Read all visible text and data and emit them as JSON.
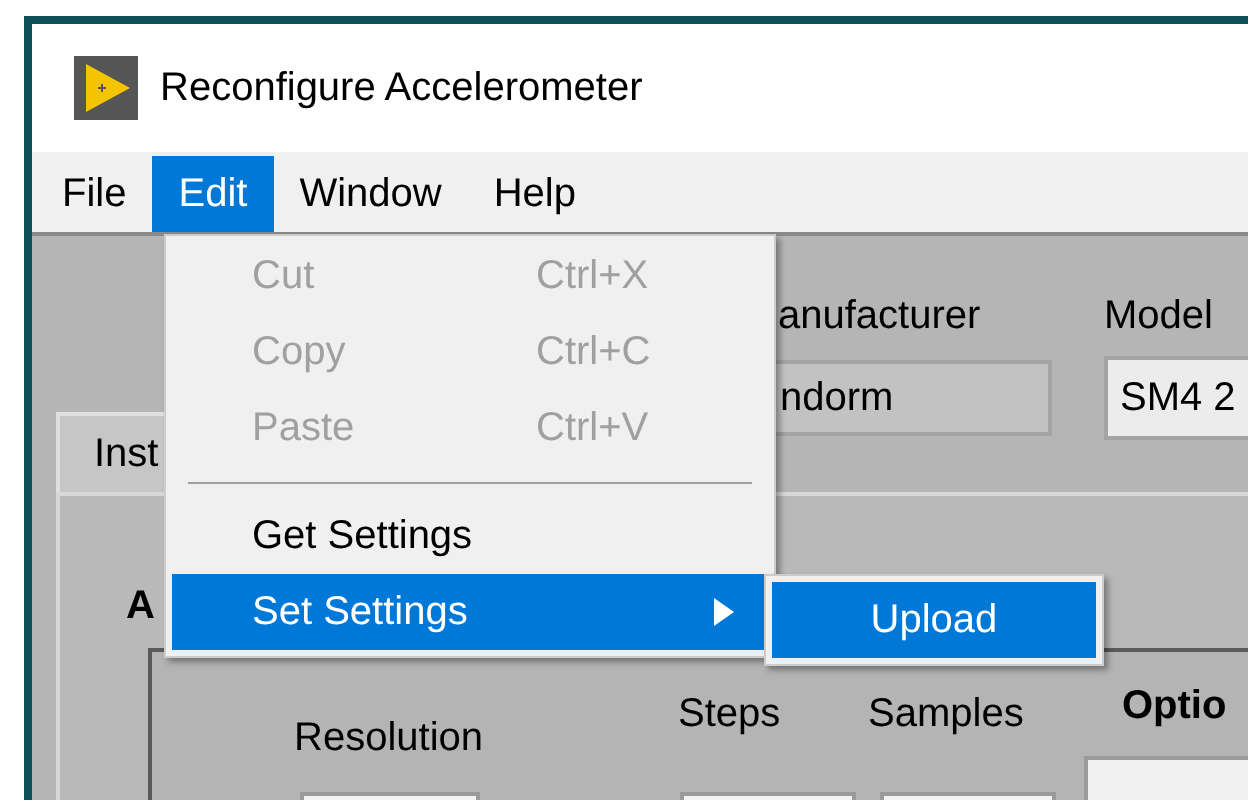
{
  "window": {
    "title": "Reconfigure Accelerometer"
  },
  "menubar": [
    {
      "label": "File",
      "selected": false
    },
    {
      "label": "Edit",
      "selected": true
    },
    {
      "label": "Window",
      "selected": false
    },
    {
      "label": "Help",
      "selected": false
    }
  ],
  "edit_menu": {
    "items": [
      {
        "kind": "command",
        "label": "Cut",
        "shortcut": "Ctrl+X",
        "disabled": true,
        "selected": false
      },
      {
        "kind": "command",
        "label": "Copy",
        "shortcut": "Ctrl+C",
        "disabled": true,
        "selected": false
      },
      {
        "kind": "command",
        "label": "Paste",
        "shortcut": "Ctrl+V",
        "disabled": true,
        "selected": false
      },
      {
        "kind": "separator"
      },
      {
        "kind": "command",
        "label": "Get Settings",
        "disabled": false,
        "selected": false
      },
      {
        "kind": "submenu",
        "label": "Set Settings",
        "disabled": false,
        "selected": true
      }
    ]
  },
  "submenu": {
    "items": [
      {
        "label": "Upload",
        "selected": true
      }
    ]
  },
  "panel": {
    "manufacturer_label": "anufacturer",
    "manufacturer_value": "ndorm",
    "model_label": "Model",
    "model_value": "SM4 2",
    "tab_label": "Inst",
    "section_label": "A",
    "resolution_label": "Resolution",
    "steps_label": "Steps",
    "samples_label": "Samples",
    "options_label": "Optio"
  }
}
